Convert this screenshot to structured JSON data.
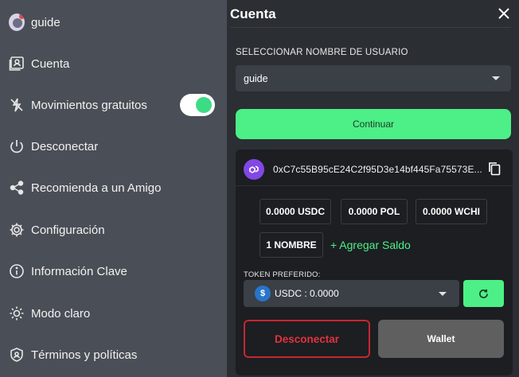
{
  "sidebar": {
    "items": [
      {
        "label": "guide",
        "icon": "avatar-icon"
      },
      {
        "label": "Cuenta",
        "icon": "account-icon"
      },
      {
        "label": "Movimientos gratuitos",
        "icon": "gas-off-icon"
      },
      {
        "label": "Desconectar",
        "icon": "power-icon"
      },
      {
        "label": "Recomienda a un Amigo",
        "icon": "share-icon"
      },
      {
        "label": "Configuración",
        "icon": "gear-icon"
      },
      {
        "label": "Información Clave",
        "icon": "info-icon"
      },
      {
        "label": "Modo claro",
        "icon": "sun-icon"
      },
      {
        "label": "Términos y políticas",
        "icon": "shield-icon"
      }
    ],
    "free_moves_toggle": true
  },
  "panel": {
    "title": "Cuenta",
    "username_label": "SELECCIONAR NOMBRE DE USUARIO",
    "username_value": "guide",
    "continue_label": "Continuar",
    "address": "0xC7c55B95cE24C2f95D3e14bf445Fa75573E...",
    "balances": [
      "0.0000 USDC",
      "0.0000 POL",
      "0.0000 WCHI",
      "1 NOMBRE"
    ],
    "add_funds_label": "+ Agregar Saldo",
    "token_label": "TOKEN PREFERIDO:",
    "token_value": "USDC : 0.0000",
    "disconnect_label": "Desconectar",
    "wallet_label": "Wallet"
  },
  "colors": {
    "accent": "#4cf086",
    "danger": "#e2323d",
    "sidebar_bg": "#4a4e56",
    "panel_bg": "#2b2e33",
    "card_bg": "#1c1e22"
  }
}
